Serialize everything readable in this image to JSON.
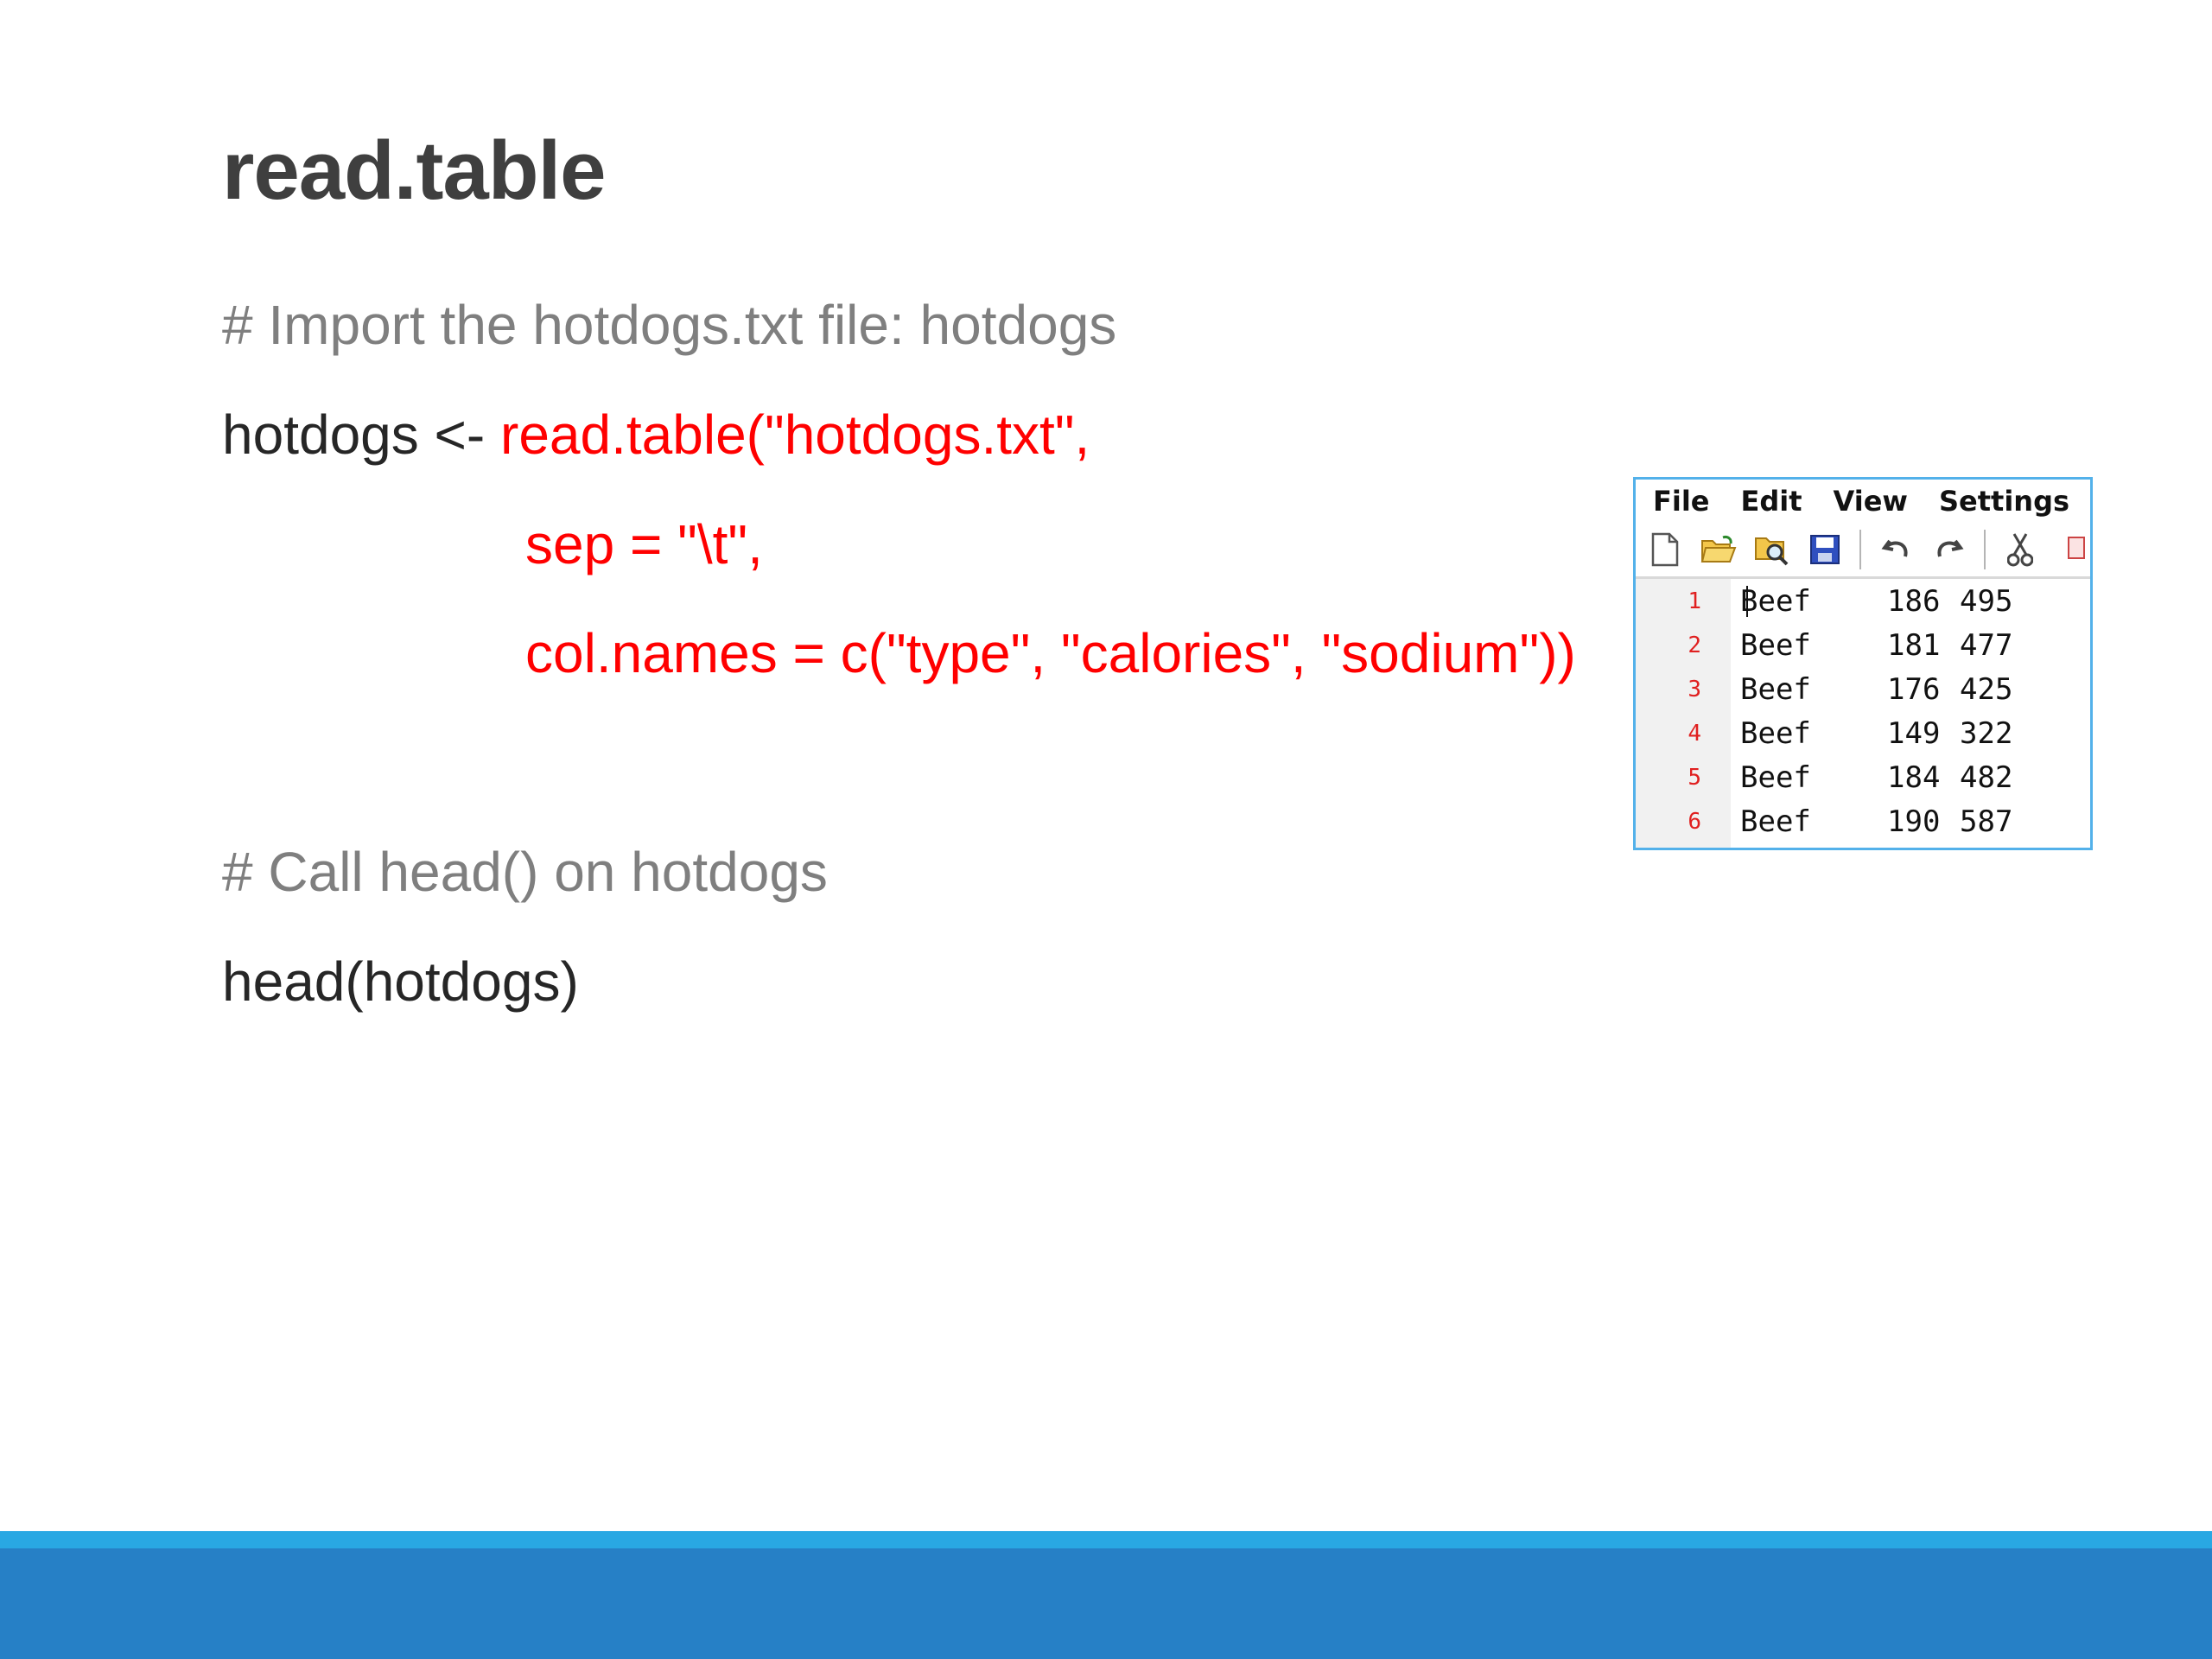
{
  "slide": {
    "title": "read.table",
    "comment1": "# Import the hotdogs.txt file: hotdogs",
    "code_line1_black": "hotdogs <- ",
    "code_line1_red": "read.table(\"hotdogs.txt\",",
    "code_line2": "sep = \"\\t\",",
    "code_line3": "col.names = c(\"type\", \"calories\", \"sodium\"))",
    "comment2": "# Call head() on hotdogs",
    "code_line4": "head(hotdogs)"
  },
  "notepad": {
    "menu": [
      "File",
      "Edit",
      "View",
      "Settings",
      "?"
    ],
    "toolbar_icons": [
      "new-file-icon",
      "open-folder-icon",
      "find-icon",
      "save-icon",
      "undo-icon",
      "redo-icon",
      "cut-icon",
      "copy-icon"
    ],
    "rows": [
      {
        "n": "1",
        "type": "Beef",
        "calories": "186",
        "sodium": "495"
      },
      {
        "n": "2",
        "type": "Beef",
        "calories": "181",
        "sodium": "477"
      },
      {
        "n": "3",
        "type": "Beef",
        "calories": "176",
        "sodium": "425"
      },
      {
        "n": "4",
        "type": "Beef",
        "calories": "149",
        "sodium": "322"
      },
      {
        "n": "5",
        "type": "Beef",
        "calories": "184",
        "sodium": "482"
      },
      {
        "n": "6",
        "type": "Beef",
        "calories": "190",
        "sodium": "587"
      }
    ]
  },
  "colors": {
    "code_red": "#ff0000",
    "comment_gray": "#7f7f7f",
    "footer_blue": "#2680c6",
    "footer_accent": "#29a8e3",
    "window_border": "#53b1ea"
  }
}
